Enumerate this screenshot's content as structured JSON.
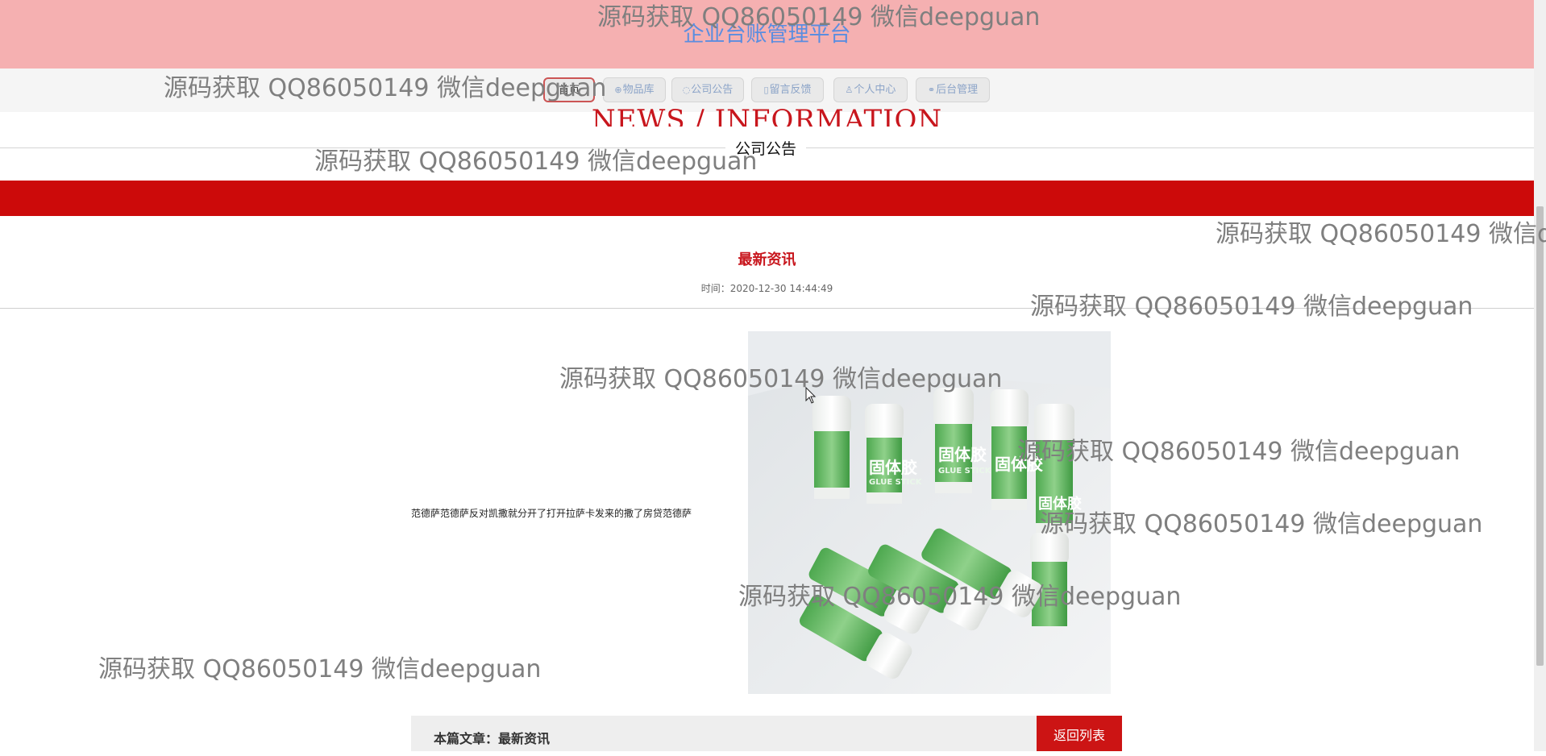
{
  "header": {
    "site_title": "企业台账管理平台"
  },
  "nav": {
    "items": [
      {
        "label": "首页",
        "icon": "home-icon",
        "glyph": ""
      },
      {
        "label": "物品库",
        "icon": "box-icon",
        "glyph": "⊕"
      },
      {
        "label": "公司公告",
        "icon": "speech-bubble-icon",
        "glyph": "◌"
      },
      {
        "label": "留言反馈",
        "icon": "note-icon",
        "glyph": "▯"
      },
      {
        "label": "个人中心",
        "icon": "user-icon",
        "glyph": "♙"
      },
      {
        "label": "后台管理",
        "icon": "link-icon",
        "glyph": "⚭"
      }
    ]
  },
  "section": {
    "title_en": "NEWS / INFORMATION",
    "label": "公司公告"
  },
  "article": {
    "title": "最新资讯",
    "time": "时间：2020-12-30 14:44:49",
    "content": "范德萨范德萨反对凯撒就分开了打开拉萨卡发来的撒了房贷范德萨",
    "image_alt": "glue sticks (固体胶 GLUE STICK)",
    "image_label_cn": "固体胶",
    "image_label_en": "GLUE STICK"
  },
  "footer": {
    "current_label": "本篇文章：最新资讯",
    "back_button": "返回列表"
  },
  "watermark": "源码获取 QQ86050149 微信deepguan",
  "colors": {
    "topbar": "#f5b0b1",
    "accent_red": "#cc0a0a",
    "title_blue": "#5a8de0"
  }
}
